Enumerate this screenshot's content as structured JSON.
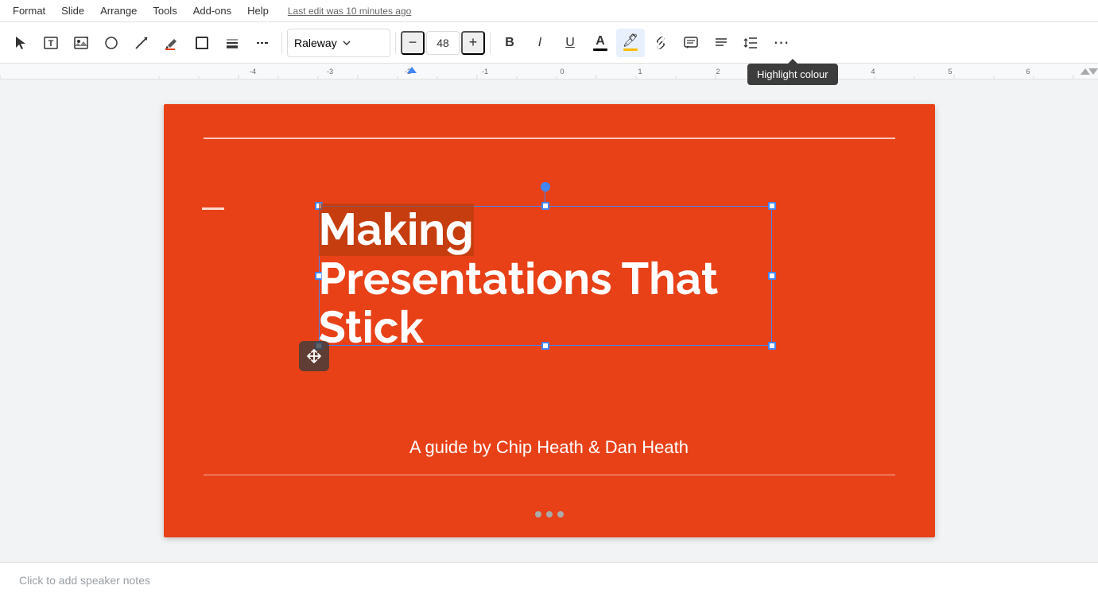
{
  "menubar": {
    "items": [
      "Format",
      "Slide",
      "Arrange",
      "Tools",
      "Add-ons",
      "Help"
    ],
    "last_edit": "Last edit was 10 minutes ago"
  },
  "toolbar": {
    "font": "Raleway",
    "font_size": "48",
    "bold_label": "B",
    "italic_label": "I",
    "underline_label": "U",
    "more_label": "⋯"
  },
  "tooltip": {
    "text": "Highlight colour"
  },
  "slide": {
    "background_color": "#e84118",
    "title_line1": "Making",
    "title_line2": "Presentations That",
    "title_line3": "Stick",
    "subtitle": "A guide by Chip Heath & Dan Heath"
  },
  "speaker_notes": {
    "placeholder": "Click to add speaker notes"
  }
}
